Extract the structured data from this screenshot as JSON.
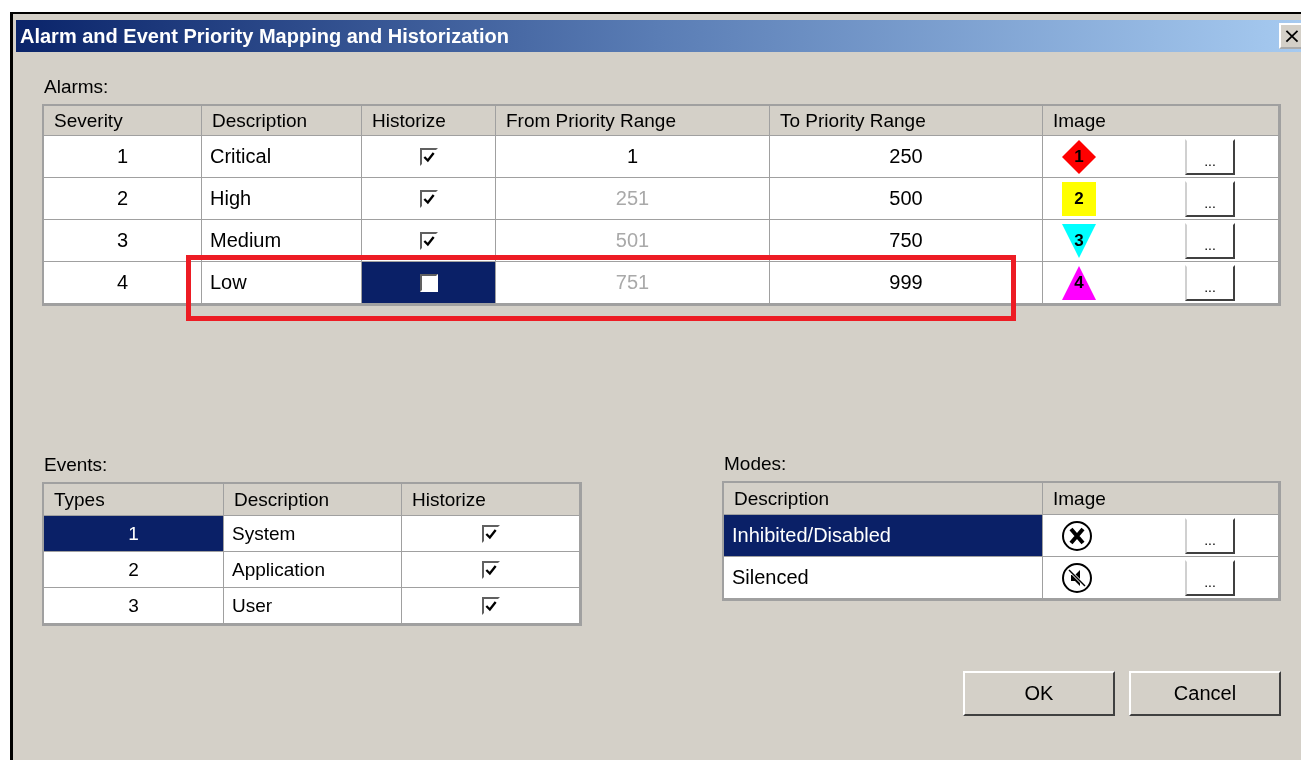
{
  "window": {
    "title": "Alarm and Event Priority Mapping and Historization",
    "close": "×"
  },
  "alarms": {
    "label": "Alarms:",
    "columns": [
      "Severity",
      "Description",
      "Historize",
      "From Priority Range",
      "To Priority Range",
      "Image"
    ],
    "rows": [
      {
        "severity": "1",
        "description": "Critical",
        "historize": true,
        "from": "1",
        "from_readonly": false,
        "to": "250",
        "image": {
          "kind": "diamond",
          "color": "#ff0000",
          "label": "1"
        },
        "browse": "...",
        "selected": false
      },
      {
        "severity": "2",
        "description": "High",
        "historize": true,
        "from": "251",
        "from_readonly": true,
        "to": "500",
        "image": {
          "kind": "square",
          "color": "#ffff00",
          "label": "2"
        },
        "browse": "...",
        "selected": false
      },
      {
        "severity": "3",
        "description": "Medium",
        "historize": true,
        "from": "501",
        "from_readonly": true,
        "to": "750",
        "image": {
          "kind": "triangle-down",
          "color": "#00ffff",
          "label": "3"
        },
        "browse": "...",
        "selected": false
      },
      {
        "severity": "4",
        "description": "Low",
        "historize": false,
        "from": "751",
        "from_readonly": true,
        "to": "999",
        "image": {
          "kind": "triangle-up",
          "color": "#ff00ff",
          "label": "4"
        },
        "browse": "...",
        "selected": true
      }
    ],
    "annotation": {
      "color": "#ed1c24"
    }
  },
  "events": {
    "label": "Events:",
    "columns": [
      "Types",
      "Description",
      "Historize"
    ],
    "rows": [
      {
        "type": "1",
        "description": "System",
        "historize": true,
        "selected": true
      },
      {
        "type": "2",
        "description": "Application",
        "historize": true,
        "selected": false
      },
      {
        "type": "3",
        "description": "User",
        "historize": true,
        "selected": false
      }
    ]
  },
  "modes": {
    "label": "Modes:",
    "columns": [
      "Description",
      "Image"
    ],
    "rows": [
      {
        "description": "Inhibited/Disabled",
        "image": {
          "kind": "x-circle"
        },
        "browse": "...",
        "selected": true
      },
      {
        "description": "Silenced",
        "image": {
          "kind": "muted-speaker"
        },
        "browse": "...",
        "selected": false
      }
    ]
  },
  "buttons": [
    "OK",
    "Cancel"
  ]
}
